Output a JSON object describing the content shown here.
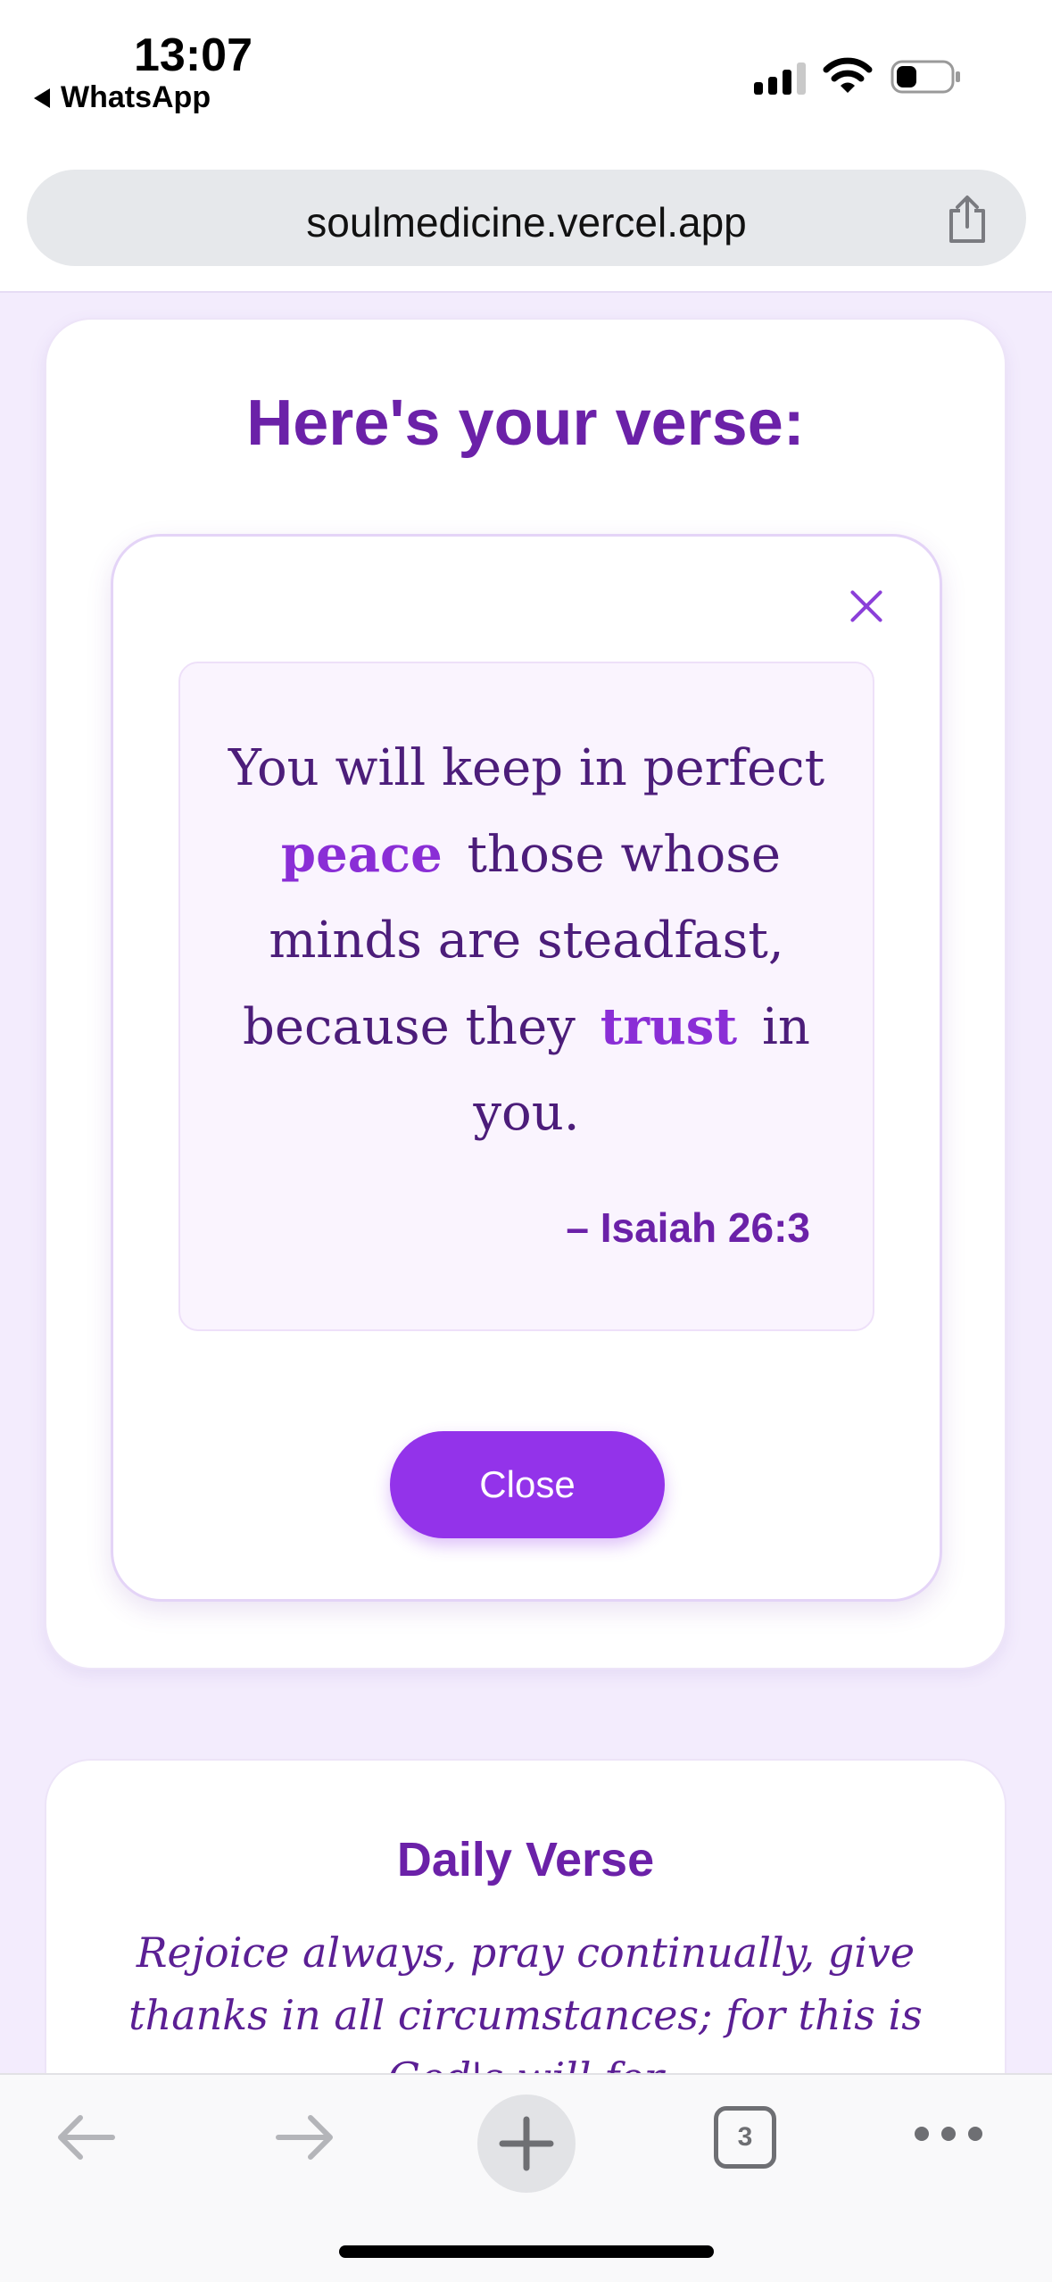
{
  "status_bar": {
    "time": "13:07",
    "back_app": "WhatsApp",
    "icons": [
      "signal-icon",
      "wifi-icon",
      "battery-icon"
    ]
  },
  "browser": {
    "url": "soulmedicine.vercel.app",
    "share_icon": "share-icon",
    "toolbar": {
      "back_icon": "back-arrow-icon",
      "forward_icon": "forward-arrow-icon",
      "new_tab_icon": "plus-icon",
      "tab_count": "3",
      "more_icon": "ellipsis-icon"
    }
  },
  "main": {
    "title": "Here's your verse:",
    "modal": {
      "close_icon": "close-icon",
      "verse": {
        "part1": "You will keep in perfect",
        "highlight1": "peace",
        "part2": "those whose minds are steadfast, because they",
        "highlight2": "trust",
        "part3": "in you."
      },
      "reference": "– Isaiah 26:3",
      "close_label": "Close"
    }
  },
  "daily": {
    "title": "Daily Verse",
    "text": "Rejoice always, pray continually, give thanks in all circumstances; for this is God's will for"
  },
  "colors": {
    "accent": "#9333ea",
    "title_purple": "#6b21a8",
    "background": "#f3ecfd"
  }
}
